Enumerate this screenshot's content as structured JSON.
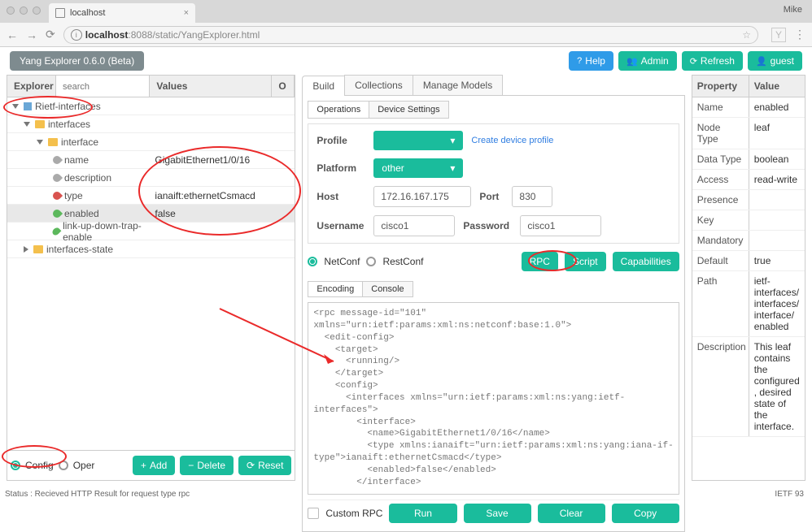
{
  "browser": {
    "tab_title": "localhost",
    "user": "Mike",
    "url_host": "localhost",
    "url_path": ":8088/static/YangExplorer.html"
  },
  "header": {
    "brand": "Yang Explorer 0.6.0 (Beta)",
    "help": "Help",
    "admin": "Admin",
    "refresh": "Refresh",
    "guest": "guest"
  },
  "explorer": {
    "title": "Explorer",
    "search_placeholder": "search",
    "values_title": "Values",
    "op_title": "O",
    "tree": [
      {
        "pad": 6,
        "label": "Rietf-interfaces",
        "pre": "tri-down",
        "icon": "box-icon"
      },
      {
        "pad": 20,
        "label": "interfaces",
        "pre": "tri-down",
        "icon": "fold"
      },
      {
        "pad": 36,
        "label": "interface",
        "pre": "tri-down",
        "icon": "fold"
      },
      {
        "pad": 56,
        "label": "name",
        "icon": "leaf leaf-gray",
        "value": "GigabitEthernet1/0/16"
      },
      {
        "pad": 56,
        "label": "description",
        "icon": "leaf leaf-gray"
      },
      {
        "pad": 56,
        "label": "type",
        "icon": "leaf leaf-red",
        "value": "ianaift:ethernetCsmacd"
      },
      {
        "pad": 56,
        "label": "enabled",
        "icon": "leaf leaf-green",
        "value": "false",
        "selected": true
      },
      {
        "pad": 56,
        "label": "link-up-down-trap-enable",
        "icon": "leaf leaf-green"
      },
      {
        "pad": 20,
        "label": "interfaces-state",
        "pre": "tri-right",
        "icon": "fold"
      }
    ],
    "footer": {
      "config": "Config",
      "oper": "Oper",
      "add": "Add",
      "delete": "Delete",
      "reset": "Reset"
    }
  },
  "mid": {
    "tabs": [
      "Build",
      "Collections",
      "Manage Models"
    ],
    "sub_tabs": [
      "Operations",
      "Device Settings"
    ],
    "form": {
      "profile_label": "Profile",
      "profile_link": "Create device profile",
      "platform_label": "Platform",
      "platform_value": "other",
      "host_label": "Host",
      "host_value": "172.16.167.175",
      "port_label": "Port",
      "port_value": "830",
      "username_label": "Username",
      "username_value": "cisco1",
      "password_label": "Password",
      "password_value": "cisco1"
    },
    "proto": {
      "netconf": "NetConf",
      "restconf": "RestConf",
      "rpc": "RPC",
      "script": "Script",
      "capabilities": "Capabilities"
    },
    "enc_tabs": [
      "Encoding",
      "Console"
    ],
    "code": "<rpc message-id=\"101\"\nxmlns=\"urn:ietf:params:xml:ns:netconf:base:1.0\">\n  <edit-config>\n    <target>\n      <running/>\n    </target>\n    <config>\n      <interfaces xmlns=\"urn:ietf:params:xml:ns:yang:ietf-\ninterfaces\">\n        <interface>\n          <name>GigabitEthernet1/0/16</name>\n          <type xmlns:ianaift=\"urn:ietf:params:xml:ns:yang:iana-if-\ntype\">ianaift:ethernetCsmacd</type>\n          <enabled>false</enabled>\n        </interface>",
    "custom": {
      "label": "Custom RPC",
      "run": "Run",
      "save": "Save",
      "clear": "Clear",
      "copy": "Copy"
    }
  },
  "props": {
    "head_k": "Property",
    "head_v": "Value",
    "rows": [
      {
        "k": "Name",
        "v": "enabled"
      },
      {
        "k": "Node Type",
        "v": "leaf"
      },
      {
        "k": "Data Type",
        "v": "boolean"
      },
      {
        "k": "Access",
        "v": "read-write"
      },
      {
        "k": "Presence",
        "v": ""
      },
      {
        "k": "Key",
        "v": ""
      },
      {
        "k": "Mandatory",
        "v": ""
      },
      {
        "k": "Default",
        "v": "true"
      },
      {
        "k": "Path",
        "v": "ietf-interfaces/ interfaces/ interface/ enabled"
      },
      {
        "k": "Description",
        "v": "This leaf contains the configured, desired state of the interface."
      }
    ]
  },
  "status": "Status : Recieved HTTP Result for request type rpc",
  "ietf": "IETF 93"
}
